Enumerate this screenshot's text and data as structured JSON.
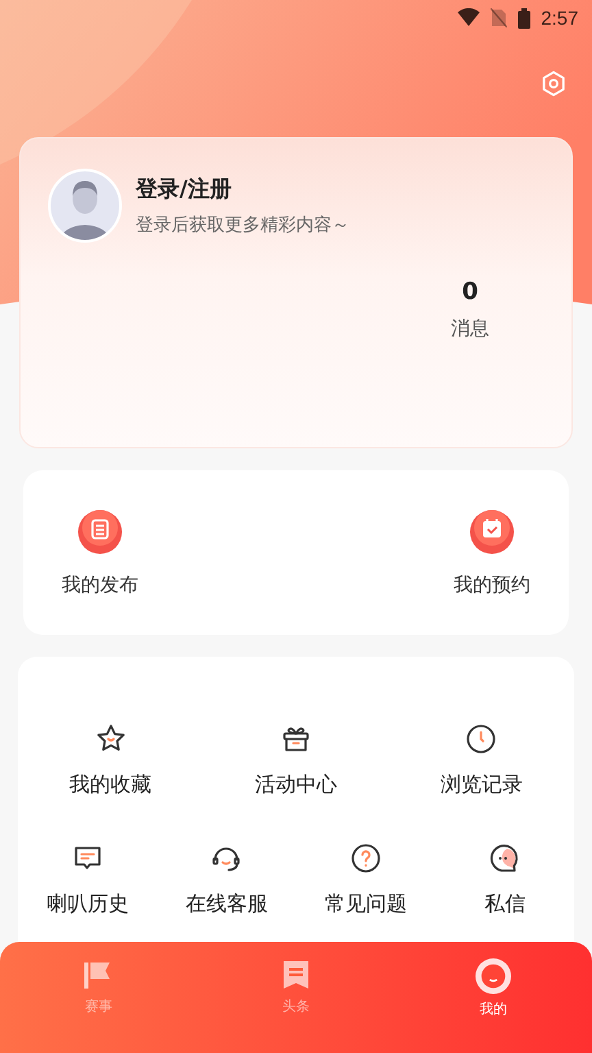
{
  "status_bar": {
    "time": "2:57"
  },
  "profile": {
    "title": "登录/注册",
    "subtitle": "登录后获取更多精彩内容～",
    "stats": [
      {
        "value": "0",
        "label": "消息"
      }
    ]
  },
  "quick_actions": [
    {
      "label": "我的发布",
      "kind": "publish"
    },
    {
      "label": "我的预约",
      "kind": "booking"
    }
  ],
  "services": [
    [
      {
        "label": "我的收藏",
        "kind": "star"
      },
      {
        "label": "活动中心",
        "kind": "gift"
      },
      {
        "label": "浏览记录",
        "kind": "clock"
      }
    ],
    [
      {
        "label": "喇叭历史",
        "kind": "chat"
      },
      {
        "label": "在线客服",
        "kind": "headset"
      },
      {
        "label": "常见问题",
        "kind": "question"
      },
      {
        "label": "私信",
        "kind": "message"
      }
    ]
  ],
  "tabs": [
    {
      "label": "赛事",
      "kind": "flag",
      "selected": false
    },
    {
      "label": "头条",
      "kind": "news",
      "selected": false
    },
    {
      "label": "我的",
      "kind": "me",
      "selected": true
    }
  ]
}
